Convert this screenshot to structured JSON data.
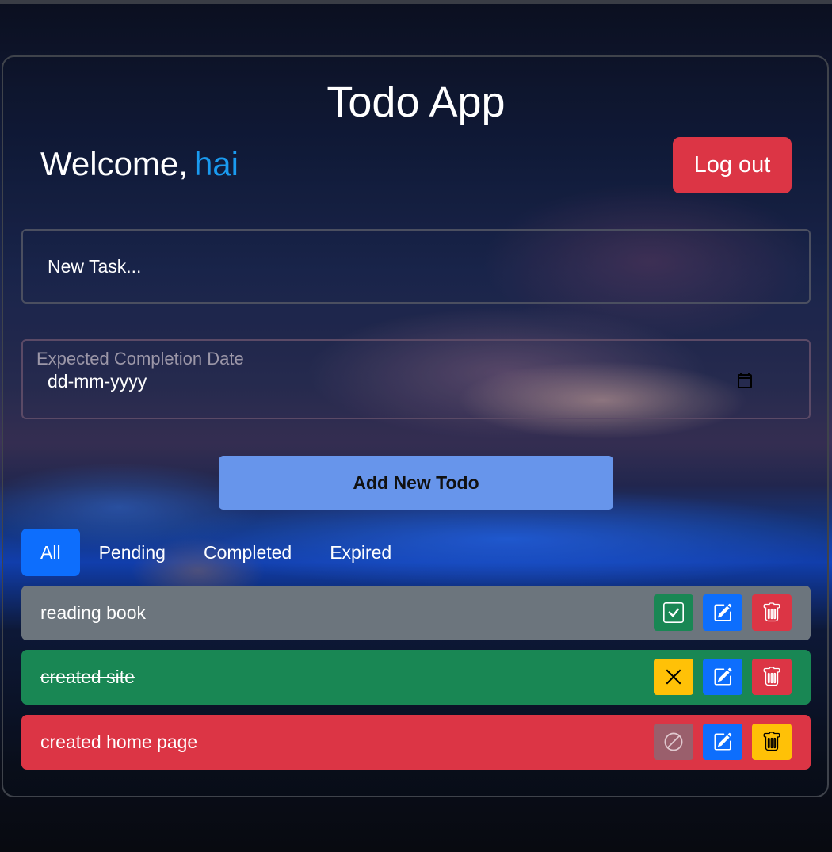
{
  "app": {
    "title": "Todo App"
  },
  "header": {
    "welcome_prefix": "Welcome,",
    "username": "hai",
    "logout_label": "Log out"
  },
  "form": {
    "task_placeholder": "New Task...",
    "task_value": "",
    "date_label": "Expected Completion Date",
    "date_placeholder": "dd-mm-yyyy",
    "add_button_label": "Add New Todo"
  },
  "tabs": [
    {
      "label": "All",
      "active": true
    },
    {
      "label": "Pending",
      "active": false
    },
    {
      "label": "Completed",
      "active": false
    },
    {
      "label": "Expired",
      "active": false
    }
  ],
  "todos": [
    {
      "text": "reading book",
      "status": "pending",
      "row_color": "#6c757d",
      "actions": [
        {
          "name": "complete-button",
          "icon": "check-square-icon",
          "color": "#198754"
        },
        {
          "name": "edit-button",
          "icon": "pencil-square-icon",
          "color": "#0d6efd"
        },
        {
          "name": "delete-button",
          "icon": "trash-icon",
          "color": "#dc3545"
        }
      ]
    },
    {
      "text": "created site",
      "status": "completed",
      "row_color": "#198754",
      "actions": [
        {
          "name": "undo-button",
          "icon": "x-icon",
          "color": "#ffc107"
        },
        {
          "name": "edit-button",
          "icon": "pencil-square-icon",
          "color": "#0d6efd"
        },
        {
          "name": "delete-button",
          "icon": "trash-icon",
          "color": "#dc3545"
        }
      ]
    },
    {
      "text": "created home page",
      "status": "expired",
      "row_color": "#dc3545",
      "actions": [
        {
          "name": "disabled-button",
          "icon": "ban-icon",
          "color": "#9a5f6c"
        },
        {
          "name": "edit-button",
          "icon": "pencil-square-icon",
          "color": "#0d6efd"
        },
        {
          "name": "delete-button",
          "icon": "trash-icon",
          "color": "#ffc107"
        }
      ]
    }
  ]
}
